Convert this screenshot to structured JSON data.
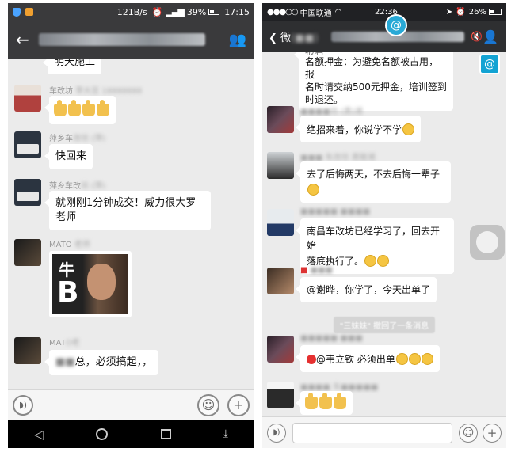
{
  "left": {
    "status": {
      "speed": "121B/s",
      "battery": "39%",
      "time": "17:15"
    },
    "messages": [
      {
        "text": "明天施工"
      },
      {
        "sender": "车改坊",
        "thumbs": 4
      },
      {
        "sender": "萍乡车",
        "text": "快回来"
      },
      {
        "sender": "萍乡车改",
        "text1": "就刚刚1分钟成交！威力很大罗",
        "text2": "老师"
      },
      {
        "sender": "MATO",
        "sticker_char_top": "牛",
        "sticker_char_bottom": "B"
      },
      {
        "sender": "MAT",
        "text": "总，必须搞起，，"
      }
    ]
  },
  "right": {
    "status": {
      "carrier": "中国联通",
      "time": "22:36",
      "battery": "26%"
    },
    "title": {
      "back": "微"
    },
    "messages": [
      {
        "text1": "报名",
        "text2": "名额押金：为避免名额被占用，报",
        "text3": "名时请交纳500元押金，培训签到",
        "text4": "时退还。"
      },
      {
        "text": "绝招来着，你说学不学"
      },
      {
        "text1": "去了后悔两天，不去后悔一辈子"
      },
      {
        "text1": "南昌车改坊已经学习了，回去开始",
        "text2": "落底执行了。"
      },
      {
        "text": "@谢晔，你学了，今天出单了"
      },
      {
        "system": "\"三妹妹\" 撤回了一条消息"
      },
      {
        "text": "@韦立钦 必须出单"
      },
      {
        "thumbs": 3
      }
    ]
  }
}
